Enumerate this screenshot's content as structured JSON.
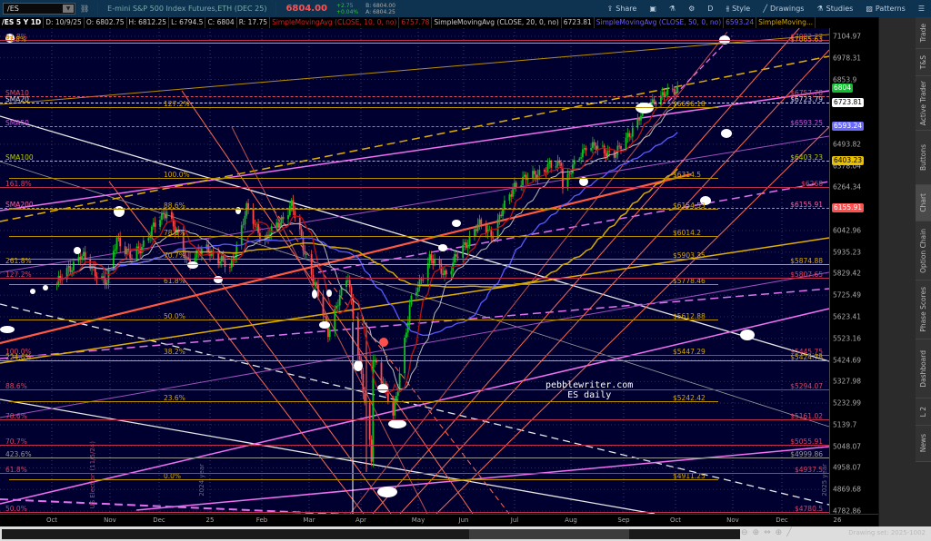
{
  "toolbar": {
    "symbol": "/ES",
    "description": "E-mini S&P 500 Index Futures,ETH (DEC 25)",
    "last": "6804.00",
    "change": "+2.75",
    "change_pct": "+0.04%",
    "bid": "B: 6804.00",
    "ask": "A: 6804.25",
    "buttons": {
      "share": "Share",
      "aggregation": "D",
      "style": "Style",
      "drawings": "Drawings",
      "studies": "Studies",
      "patterns": "Patterns"
    }
  },
  "infobar": {
    "symbol_period": "/ES 5 Y 1D",
    "date": "D: 10/9/25",
    "open": "O: 6802.75",
    "high": "H: 6812.25",
    "low": "L: 6794.5",
    "close": "C: 6804",
    "range": "R: 17.75",
    "studies": [
      {
        "name": "SimpleMovingAvg (CLOSE, 10, 0, no)",
        "value": "6757.78",
        "color": "#d02020"
      },
      {
        "name": "SimpleMovingAvg (CLOSE, 20, 0, no)",
        "value": "6723.81",
        "color": "#cccccc"
      },
      {
        "name": "SimpleMovingAvg (CLOSE, 50, 0, no)",
        "value": "6593.24",
        "color": "#6a5cff"
      },
      {
        "name": "SimpleMoving...",
        "value": "",
        "color": "#d4a800"
      }
    ]
  },
  "price_axis": {
    "ticks": [
      7104.97,
      6978.31,
      6853.9,
      6493.82,
      6378.04,
      6264.34,
      6042.96,
      5935.23,
      5829.42,
      5725.49,
      5623.41,
      5523.16,
      5424.69,
      5327.98,
      5232.99,
      5139.7,
      5048.07,
      4958.07,
      4869.68,
      4782.86
    ],
    "range": [
      4782.86,
      7104.97
    ],
    "scale": "log",
    "badges": [
      {
        "label": "6804",
        "price": 6804,
        "bg": "#10c030",
        "fg": "#fff"
      },
      {
        "label": "6723.81",
        "price": 6723.81,
        "bg": "#ffffff",
        "fg": "#000"
      },
      {
        "label": "6593.24",
        "price": 6593.24,
        "bg": "#6a6aff",
        "fg": "#fff"
      },
      {
        "label": "6403.23",
        "price": 6403.23,
        "bg": "#e8c000",
        "fg": "#000"
      },
      {
        "label": "6155.91",
        "price": 6155.91,
        "bg": "#ff5050",
        "fg": "#fff"
      }
    ]
  },
  "time_axis": {
    "labels": [
      "Oct",
      "Nov",
      "Dec",
      "25",
      "Feb",
      "Mar",
      "Apr",
      "May",
      "Jun",
      "Jul",
      "Aug",
      "Sep",
      "Oct",
      "Nov",
      "Dec",
      "26"
    ]
  },
  "sma_levels": [
    {
      "label": "SMA10",
      "value_label": "$6757.78",
      "price": 6757.78,
      "color": "#e05060"
    },
    {
      "label": "SMA20",
      "value_label": "$6723.79",
      "price": 6723.79,
      "color": "#dddddd"
    },
    {
      "label": "SMA50",
      "value_label": "$6593.25",
      "price": 6593.25,
      "color": "#d050e0"
    },
    {
      "label": "SMA100",
      "value_label": "$6403.23",
      "price": 6403.23,
      "color": "#b8d000"
    },
    {
      "label": "SMA200",
      "value_label": "$6155.91",
      "price": 6155.91,
      "color": "#ff60a0"
    }
  ],
  "gold_fib": [
    {
      "pct": "127.2%",
      "value_label": "$6696.18",
      "price": 6696.18
    },
    {
      "pct": "100.0%",
      "value_label": "$6314.5",
      "price": 6314.5
    },
    {
      "pct": "88.6%",
      "value_label": "$6154.53",
      "price": 6154.53
    },
    {
      "pct": "78.6%",
      "value_label": "$6014.2",
      "price": 6014.2
    },
    {
      "pct": "70.7%",
      "value_label": "$5903.35",
      "price": 5903.35
    },
    {
      "pct": "61.8%",
      "value_label": "$5778.46",
      "price": 5778.46
    },
    {
      "pct": "50.0%",
      "value_label": "$5612.88",
      "price": 5612.88
    },
    {
      "pct": "38.2%",
      "value_label": "$5447.29",
      "price": 5447.29
    },
    {
      "pct": "23.6%",
      "value_label": "$5242.42",
      "price": 5242.42
    },
    {
      "pct": "0.0%",
      "value_label": "$4911.25",
      "price": 4911.25
    }
  ],
  "red_fib": [
    {
      "pct": "61.8%",
      "value_label": "$7082.27",
      "price": 7082.27,
      "color": "#e04060"
    },
    {
      "pct": "161.8%",
      "value_label": "$6268",
      "price": 6268,
      "color": "#e04060"
    },
    {
      "pct": "127.2%",
      "value_label": "$5807.65",
      "price": 5807.65,
      "color": "#e04060"
    },
    {
      "pct": "100.0%",
      "value_label": "$5445.75",
      "price": 5445.75,
      "color": "#e04060"
    },
    {
      "pct": "88.6%",
      "value_label": "$5294.07",
      "price": 5294.07,
      "color": "#e04060"
    },
    {
      "pct": "78.6%",
      "value_label": "$5161.02",
      "price": 5161.02,
      "color": "#e04060"
    },
    {
      "pct": "70.7%",
      "value_label": "$5055.91",
      "price": 5055.91,
      "color": "#e04060"
    },
    {
      "pct": "61.8%",
      "value_label": "$4937.5",
      "price": 4937.5,
      "color": "#e04060"
    },
    {
      "pct": "50.0%",
      "value_label": "$4780.5",
      "price": 4780.5,
      "color": "#e04060"
    }
  ],
  "ext_fib": [
    {
      "pct": "?1.8%",
      "value_label": "$7065.63",
      "price": 7065.63,
      "color": "#d4a800"
    },
    {
      "pct": "261.8%",
      "value_label": "$5874.88",
      "price": 5874.88,
      "color": "#d4a800"
    },
    {
      "pct": "224.6%",
      "value_label": "$5424.78",
      "price": 5424.78,
      "color": "#d4a800"
    },
    {
      "pct": "423.6%",
      "value_label": "$4999.86",
      "price": 4999.86,
      "color": "#999999"
    }
  ],
  "annotations": {
    "site": "pebblewriter.com",
    "caption": "ES daily",
    "election": "US Election (11/5/24)",
    "year2024": "2024 year",
    "year2025": "2025 year"
  },
  "price_path": [
    [
      "2024-10-01",
      5780
    ],
    [
      "2024-10-15",
      5920
    ],
    [
      "2024-10-31",
      5780
    ],
    [
      "2024-11-06",
      6010
    ],
    [
      "2024-11-15",
      5900
    ],
    [
      "2024-12-06",
      6150
    ],
    [
      "2024-12-18",
      5900
    ],
    [
      "2024-12-31",
      5950
    ],
    [
      "2025-01-13",
      5850
    ],
    [
      "2025-01-23",
      6150
    ],
    [
      "2025-02-03",
      5990
    ],
    [
      "2025-02-19",
      6170
    ],
    [
      "2025-03-04",
      5800
    ],
    [
      "2025-03-13",
      5560
    ],
    [
      "2025-03-25",
      5820
    ],
    [
      "2025-04-08",
      4990
    ],
    [
      "2025-04-09",
      5450
    ],
    [
      "2025-04-21",
      5180
    ],
    [
      "2025-05-02",
      5700
    ],
    [
      "2025-05-13",
      5900
    ],
    [
      "2025-05-23",
      5830
    ],
    [
      "2025-06-11",
      6070
    ],
    [
      "2025-06-20",
      6030
    ],
    [
      "2025-07-03",
      6280
    ],
    [
      "2025-07-31",
      6400
    ],
    [
      "2025-08-01",
      6270
    ],
    [
      "2025-08-15",
      6490
    ],
    [
      "2025-09-02",
      6440
    ],
    [
      "2025-09-22",
      6720
    ],
    [
      "2025-10-09",
      6804
    ]
  ],
  "side_tabs": [
    "Trade",
    "T&S",
    "Active Trader",
    "Buttons",
    "Chart",
    "Option Chain",
    "Phase Scores",
    "Dashboard",
    "L 2",
    "News"
  ],
  "selected_tab": "Chart",
  "footer": {
    "drawing_set": "Drawing set: 2025-1002"
  },
  "colors": {
    "up": "#10c020",
    "down": "#ff4a4a",
    "background": "#000030",
    "gold": "#d4a800"
  }
}
